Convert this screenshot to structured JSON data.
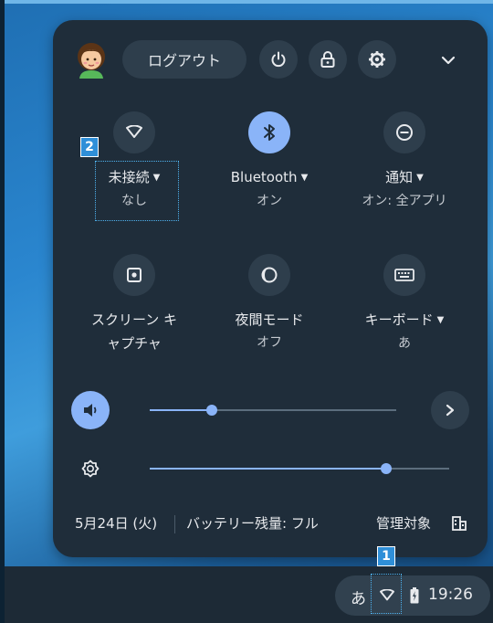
{
  "colors": {
    "accent": "#8ab4f8",
    "panel": "#1f2d3a",
    "button": "#2e3e4c",
    "callout": "#2f8fd8"
  },
  "header": {
    "avatar_icon": "user-avatar",
    "logout_label": "ログアウト",
    "power_icon": "power-icon",
    "lock_icon": "lock-icon",
    "settings_icon": "gear-icon",
    "collapse_icon": "chevron-down-icon"
  },
  "tiles": [
    {
      "title": "未接続",
      "status": "なし",
      "icon": "wifi-icon",
      "has_menu": true,
      "active": false
    },
    {
      "title": "Bluetooth",
      "status": "オン",
      "icon": "bluetooth-icon",
      "has_menu": true,
      "active": true
    },
    {
      "title": "通知",
      "status": "オン: 全アプリ",
      "icon": "do-not-disturb-icon",
      "has_menu": true,
      "active": false
    },
    {
      "title_line1": "スクリーン キ",
      "title_line2": "ャプチャ",
      "icon": "screen-capture-icon",
      "has_menu": false,
      "active": false
    },
    {
      "title": "夜間モード",
      "status": "オフ",
      "icon": "night-light-icon",
      "has_menu": false,
      "active": false
    },
    {
      "title": "キーボード",
      "status": "あ",
      "icon": "keyboard-icon",
      "has_menu": true,
      "active": false
    }
  ],
  "sliders": {
    "volume": {
      "icon": "volume-icon",
      "level": 0.25
    },
    "brightness": {
      "icon": "brightness-icon",
      "level": 0.79
    },
    "audio_settings_icon": "chevron-right-icon"
  },
  "footer": {
    "date": "5月24日 (火)",
    "battery": "バッテリー残量: フル",
    "managed": "管理対象",
    "managed_icon": "building-icon"
  },
  "shelf": {
    "ime": "あ",
    "network_icon": "wifi-icon",
    "battery_icon": "battery-icon",
    "time": "19:26"
  },
  "callouts": {
    "one": "1",
    "two": "2"
  }
}
